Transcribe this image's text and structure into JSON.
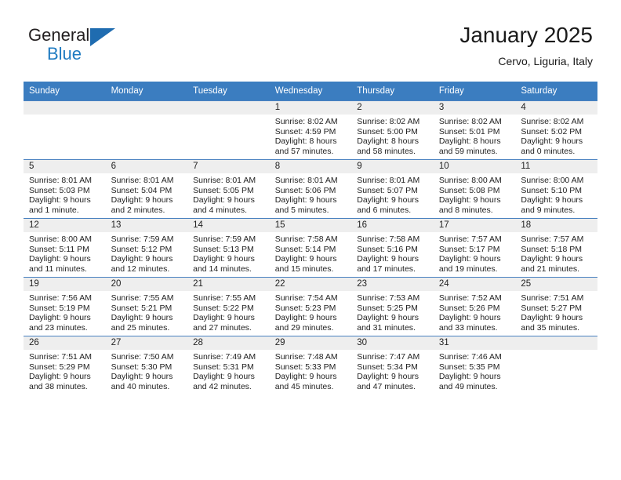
{
  "brand": {
    "name_part1": "General",
    "name_part2": "Blue",
    "triangle_color": "#1f6cb0",
    "blue_color": "#1f7bc1"
  },
  "header": {
    "title": "January 2025",
    "location": "Cervo, Liguria, Italy"
  },
  "theme": {
    "header_row_bg": "#3b7dc0",
    "day_number_bg": "#eeeeee",
    "grid_line": "#4a82c0",
    "text": "#222222"
  },
  "weekday_headers": [
    "Sunday",
    "Monday",
    "Tuesday",
    "Wednesday",
    "Thursday",
    "Friday",
    "Saturday"
  ],
  "weeks": [
    [
      {
        "day": "",
        "sunrise": "",
        "sunset": "",
        "daylight_line1": "",
        "daylight_line2": ""
      },
      {
        "day": "",
        "sunrise": "",
        "sunset": "",
        "daylight_line1": "",
        "daylight_line2": ""
      },
      {
        "day": "",
        "sunrise": "",
        "sunset": "",
        "daylight_line1": "",
        "daylight_line2": ""
      },
      {
        "day": "1",
        "sunrise": "Sunrise: 8:02 AM",
        "sunset": "Sunset: 4:59 PM",
        "daylight_line1": "Daylight: 8 hours",
        "daylight_line2": "and 57 minutes."
      },
      {
        "day": "2",
        "sunrise": "Sunrise: 8:02 AM",
        "sunset": "Sunset: 5:00 PM",
        "daylight_line1": "Daylight: 8 hours",
        "daylight_line2": "and 58 minutes."
      },
      {
        "day": "3",
        "sunrise": "Sunrise: 8:02 AM",
        "sunset": "Sunset: 5:01 PM",
        "daylight_line1": "Daylight: 8 hours",
        "daylight_line2": "and 59 minutes."
      },
      {
        "day": "4",
        "sunrise": "Sunrise: 8:02 AM",
        "sunset": "Sunset: 5:02 PM",
        "daylight_line1": "Daylight: 9 hours",
        "daylight_line2": "and 0 minutes."
      }
    ],
    [
      {
        "day": "5",
        "sunrise": "Sunrise: 8:01 AM",
        "sunset": "Sunset: 5:03 PM",
        "daylight_line1": "Daylight: 9 hours",
        "daylight_line2": "and 1 minute."
      },
      {
        "day": "6",
        "sunrise": "Sunrise: 8:01 AM",
        "sunset": "Sunset: 5:04 PM",
        "daylight_line1": "Daylight: 9 hours",
        "daylight_line2": "and 2 minutes."
      },
      {
        "day": "7",
        "sunrise": "Sunrise: 8:01 AM",
        "sunset": "Sunset: 5:05 PM",
        "daylight_line1": "Daylight: 9 hours",
        "daylight_line2": "and 4 minutes."
      },
      {
        "day": "8",
        "sunrise": "Sunrise: 8:01 AM",
        "sunset": "Sunset: 5:06 PM",
        "daylight_line1": "Daylight: 9 hours",
        "daylight_line2": "and 5 minutes."
      },
      {
        "day": "9",
        "sunrise": "Sunrise: 8:01 AM",
        "sunset": "Sunset: 5:07 PM",
        "daylight_line1": "Daylight: 9 hours",
        "daylight_line2": "and 6 minutes."
      },
      {
        "day": "10",
        "sunrise": "Sunrise: 8:00 AM",
        "sunset": "Sunset: 5:08 PM",
        "daylight_line1": "Daylight: 9 hours",
        "daylight_line2": "and 8 minutes."
      },
      {
        "day": "11",
        "sunrise": "Sunrise: 8:00 AM",
        "sunset": "Sunset: 5:10 PM",
        "daylight_line1": "Daylight: 9 hours",
        "daylight_line2": "and 9 minutes."
      }
    ],
    [
      {
        "day": "12",
        "sunrise": "Sunrise: 8:00 AM",
        "sunset": "Sunset: 5:11 PM",
        "daylight_line1": "Daylight: 9 hours",
        "daylight_line2": "and 11 minutes."
      },
      {
        "day": "13",
        "sunrise": "Sunrise: 7:59 AM",
        "sunset": "Sunset: 5:12 PM",
        "daylight_line1": "Daylight: 9 hours",
        "daylight_line2": "and 12 minutes."
      },
      {
        "day": "14",
        "sunrise": "Sunrise: 7:59 AM",
        "sunset": "Sunset: 5:13 PM",
        "daylight_line1": "Daylight: 9 hours",
        "daylight_line2": "and 14 minutes."
      },
      {
        "day": "15",
        "sunrise": "Sunrise: 7:58 AM",
        "sunset": "Sunset: 5:14 PM",
        "daylight_line1": "Daylight: 9 hours",
        "daylight_line2": "and 15 minutes."
      },
      {
        "day": "16",
        "sunrise": "Sunrise: 7:58 AM",
        "sunset": "Sunset: 5:16 PM",
        "daylight_line1": "Daylight: 9 hours",
        "daylight_line2": "and 17 minutes."
      },
      {
        "day": "17",
        "sunrise": "Sunrise: 7:57 AM",
        "sunset": "Sunset: 5:17 PM",
        "daylight_line1": "Daylight: 9 hours",
        "daylight_line2": "and 19 minutes."
      },
      {
        "day": "18",
        "sunrise": "Sunrise: 7:57 AM",
        "sunset": "Sunset: 5:18 PM",
        "daylight_line1": "Daylight: 9 hours",
        "daylight_line2": "and 21 minutes."
      }
    ],
    [
      {
        "day": "19",
        "sunrise": "Sunrise: 7:56 AM",
        "sunset": "Sunset: 5:19 PM",
        "daylight_line1": "Daylight: 9 hours",
        "daylight_line2": "and 23 minutes."
      },
      {
        "day": "20",
        "sunrise": "Sunrise: 7:55 AM",
        "sunset": "Sunset: 5:21 PM",
        "daylight_line1": "Daylight: 9 hours",
        "daylight_line2": "and 25 minutes."
      },
      {
        "day": "21",
        "sunrise": "Sunrise: 7:55 AM",
        "sunset": "Sunset: 5:22 PM",
        "daylight_line1": "Daylight: 9 hours",
        "daylight_line2": "and 27 minutes."
      },
      {
        "day": "22",
        "sunrise": "Sunrise: 7:54 AM",
        "sunset": "Sunset: 5:23 PM",
        "daylight_line1": "Daylight: 9 hours",
        "daylight_line2": "and 29 minutes."
      },
      {
        "day": "23",
        "sunrise": "Sunrise: 7:53 AM",
        "sunset": "Sunset: 5:25 PM",
        "daylight_line1": "Daylight: 9 hours",
        "daylight_line2": "and 31 minutes."
      },
      {
        "day": "24",
        "sunrise": "Sunrise: 7:52 AM",
        "sunset": "Sunset: 5:26 PM",
        "daylight_line1": "Daylight: 9 hours",
        "daylight_line2": "and 33 minutes."
      },
      {
        "day": "25",
        "sunrise": "Sunrise: 7:51 AM",
        "sunset": "Sunset: 5:27 PM",
        "daylight_line1": "Daylight: 9 hours",
        "daylight_line2": "and 35 minutes."
      }
    ],
    [
      {
        "day": "26",
        "sunrise": "Sunrise: 7:51 AM",
        "sunset": "Sunset: 5:29 PM",
        "daylight_line1": "Daylight: 9 hours",
        "daylight_line2": "and 38 minutes."
      },
      {
        "day": "27",
        "sunrise": "Sunrise: 7:50 AM",
        "sunset": "Sunset: 5:30 PM",
        "daylight_line1": "Daylight: 9 hours",
        "daylight_line2": "and 40 minutes."
      },
      {
        "day": "28",
        "sunrise": "Sunrise: 7:49 AM",
        "sunset": "Sunset: 5:31 PM",
        "daylight_line1": "Daylight: 9 hours",
        "daylight_line2": "and 42 minutes."
      },
      {
        "day": "29",
        "sunrise": "Sunrise: 7:48 AM",
        "sunset": "Sunset: 5:33 PM",
        "daylight_line1": "Daylight: 9 hours",
        "daylight_line2": "and 45 minutes."
      },
      {
        "day": "30",
        "sunrise": "Sunrise: 7:47 AM",
        "sunset": "Sunset: 5:34 PM",
        "daylight_line1": "Daylight: 9 hours",
        "daylight_line2": "and 47 minutes."
      },
      {
        "day": "31",
        "sunrise": "Sunrise: 7:46 AM",
        "sunset": "Sunset: 5:35 PM",
        "daylight_line1": "Daylight: 9 hours",
        "daylight_line2": "and 49 minutes."
      },
      {
        "day": "",
        "sunrise": "",
        "sunset": "",
        "daylight_line1": "",
        "daylight_line2": ""
      }
    ]
  ]
}
